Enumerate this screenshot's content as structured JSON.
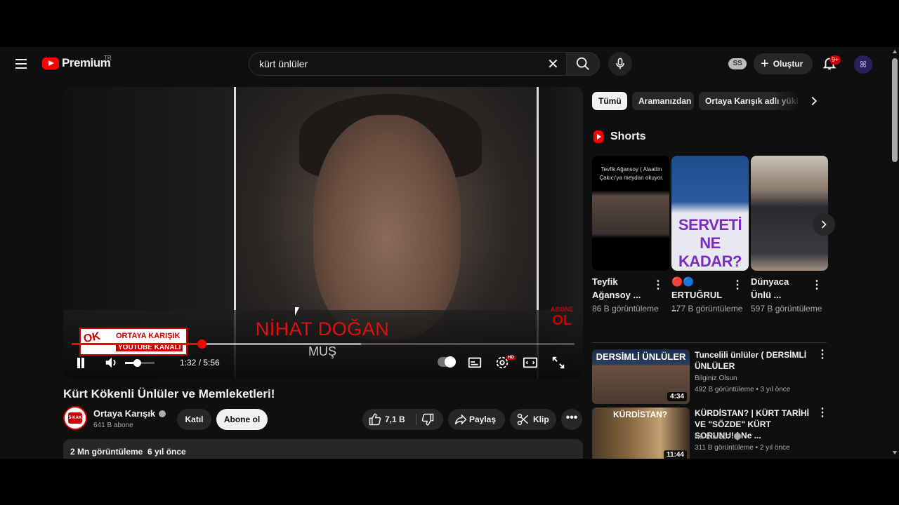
{
  "header": {
    "logo_text": "Premium",
    "country": "TR",
    "search_value": "kürt ünlüler",
    "ss_badge": "SS",
    "create_label": "Oluştur",
    "notif_count": "9+"
  },
  "player": {
    "caption_name": "NİHAT DOĞAN",
    "caption_city": "MUŞ",
    "stamp_line1": "ORTAYA KARIŞIK",
    "stamp_line2": "YOUTUBE KANALI",
    "stamp_logo": "OK",
    "abone_top": "ABONE",
    "abone_big": "OL",
    "time": "1:32 / 5:56",
    "progress_fraction": 0.258,
    "buffer_fraction": 0.575,
    "volume_fraction": 0.4,
    "hd_label": "HD"
  },
  "video": {
    "title": "Kürt Kökenli Ünlüler ve Memleketleri!",
    "channel": "Ortaya Karışık",
    "subscribers": "641 B abone",
    "join_label": "Katıl",
    "subscribe_label": "Abone ol",
    "likes": "7,1 B",
    "share_label": "Paylaş",
    "clip_label": "Klip",
    "views_date": "2 Mn görüntüleme  6 yıl önce",
    "avatar_text": "5-KAK"
  },
  "chips": [
    "Tümü",
    "Aramanızdan",
    "Ortaya Karışık adlı yükle"
  ],
  "shorts": {
    "title": "Shorts",
    "items": [
      {
        "title": "Teyfik Ağansoy ...",
        "views": "86 B görüntüleme",
        "overlay": "Tevfik Ağansoy ( Alaattin Çakıcı'ya meydan okuyor."
      },
      {
        "title": "🔴🔵 ERTUĞRUL ...",
        "views": "177 B görüntüleme",
        "overlay": "SERVETİ NE KADAR?"
      },
      {
        "title": "Dünyaca Ünlü ...",
        "views": "597 B görüntüleme",
        "overlay": ""
      }
    ]
  },
  "recommendations": [
    {
      "title": "Tuncelili ünlüler ( DERSİMLİ ÜNLÜLER",
      "channel": "Bilginiz Olsun",
      "meta": "492 B görüntüleme • 3 yıl önce",
      "duration": "4:34",
      "thumb_text": "DERSİMLİ ÜNLÜLER"
    },
    {
      "title": "KÜRDİSTAN? | KÜRT TARİHİ VE \"SÖZDE\" KÜRT SORUNU! | Ne ...",
      "channel": "Ne Olurdu?",
      "meta": "311 B görüntüleme • 2 yıl önce",
      "duration": "11:44",
      "thumb_text": "KÜRDİSTAN?"
    }
  ],
  "colors": {
    "accent": "#ff0000",
    "background": "#0f0f0f",
    "surface": "#272727"
  }
}
